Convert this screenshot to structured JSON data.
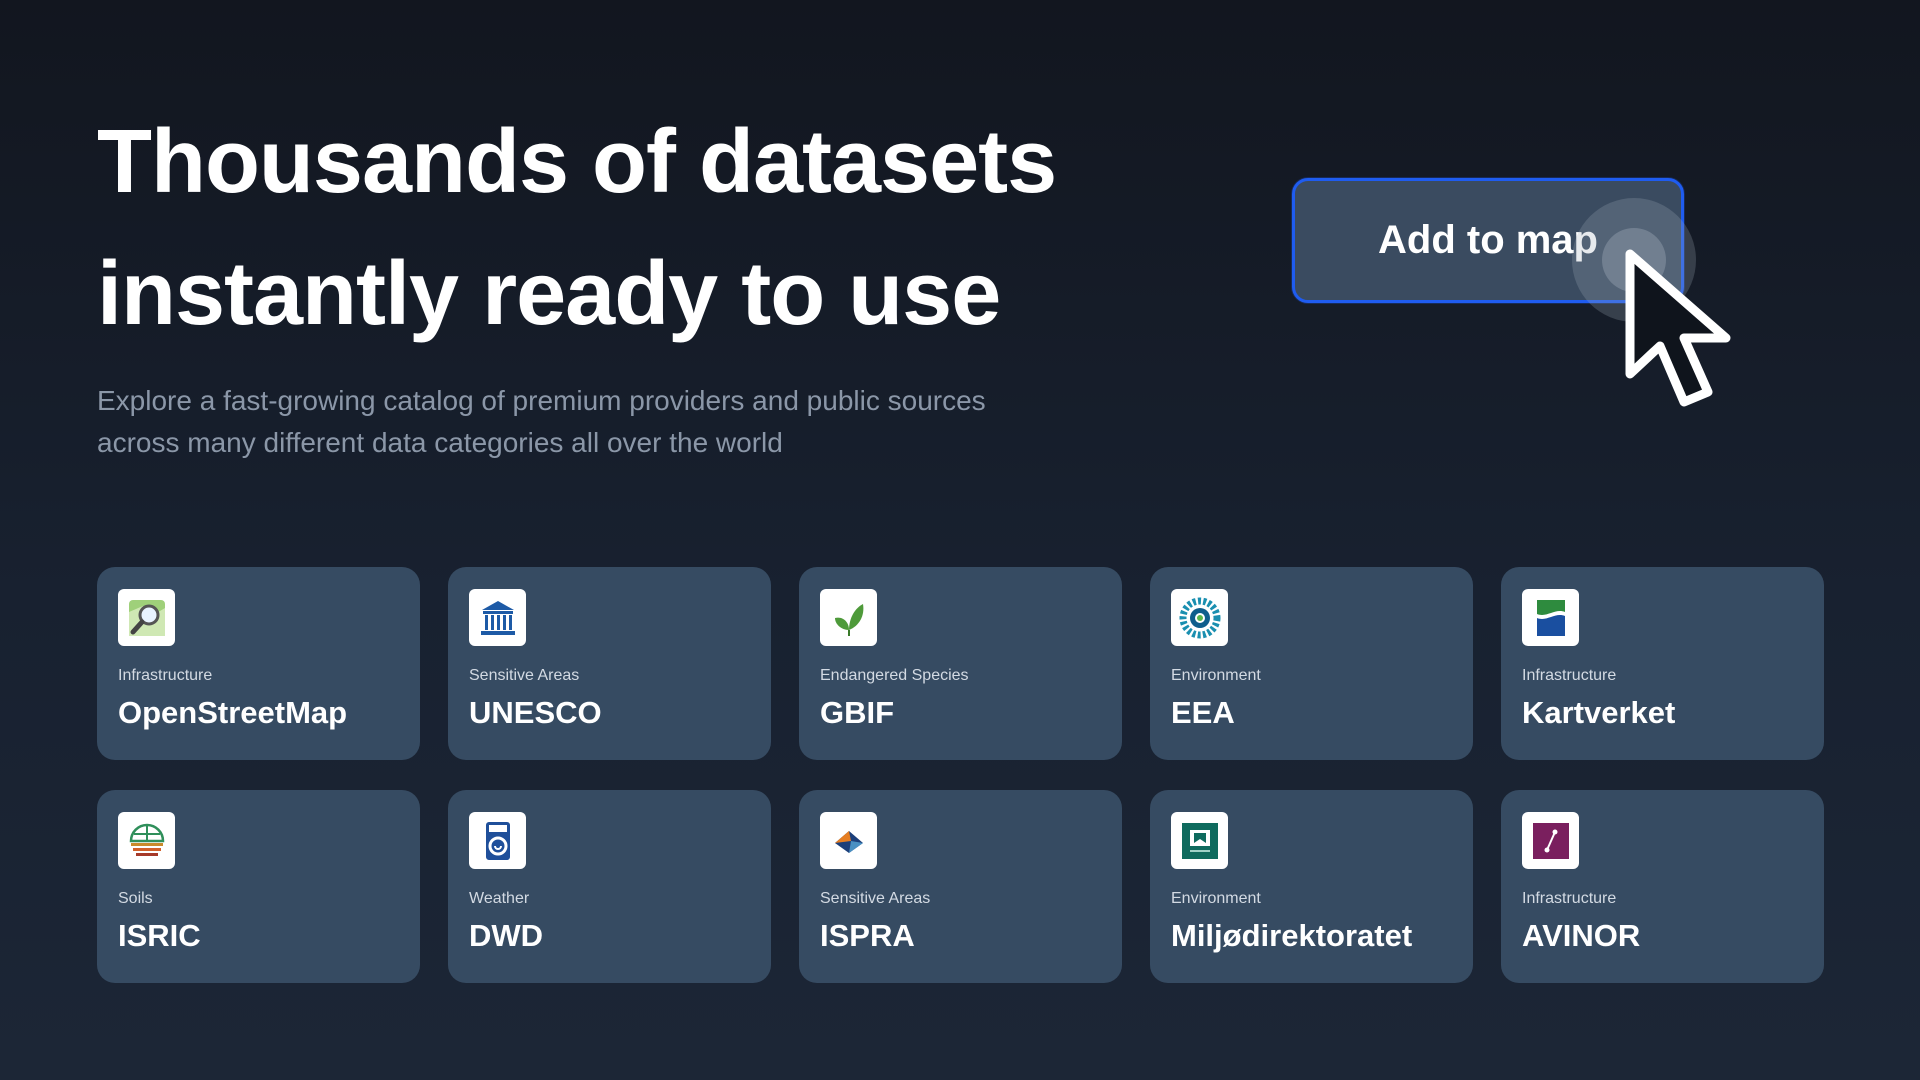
{
  "hero": {
    "headline_line1": "Thousands of datasets",
    "headline_line2": "instantly ready to use",
    "subtitle_line1": "Explore a fast-growing catalog of premium providers and public sources",
    "subtitle_line2": "across many different data categories all over the world"
  },
  "cta": {
    "label": "Add to map",
    "border_color": "#1f5cf0"
  },
  "providers": [
    {
      "category": "Infrastructure",
      "name": "OpenStreetMap",
      "icon": "openstreetmap-logo-icon"
    },
    {
      "category": "Sensitive Areas",
      "name": "UNESCO",
      "icon": "unesco-logo-icon"
    },
    {
      "category": "Endangered Species",
      "name": "GBIF",
      "icon": "gbif-logo-icon"
    },
    {
      "category": "Environment",
      "name": "EEA",
      "icon": "eea-logo-icon"
    },
    {
      "category": "Infrastructure",
      "name": "Kartverket",
      "icon": "kartverket-logo-icon"
    },
    {
      "category": "Soils",
      "name": "ISRIC",
      "icon": "isric-logo-icon"
    },
    {
      "category": "Weather",
      "name": "DWD",
      "icon": "dwd-logo-icon"
    },
    {
      "category": "Sensitive Areas",
      "name": "ISPRA",
      "icon": "ispra-logo-icon"
    },
    {
      "category": "Environment",
      "name": "Miljødirektoratet",
      "icon": "miljodirektoratet-logo-icon"
    },
    {
      "category": "Infrastructure",
      "name": "AVINOR",
      "icon": "avinor-logo-icon"
    }
  ],
  "colors": {
    "background": "#141a25",
    "card": "#364b62",
    "subtitle": "#8b97a8",
    "accent": "#1f5cf0"
  }
}
